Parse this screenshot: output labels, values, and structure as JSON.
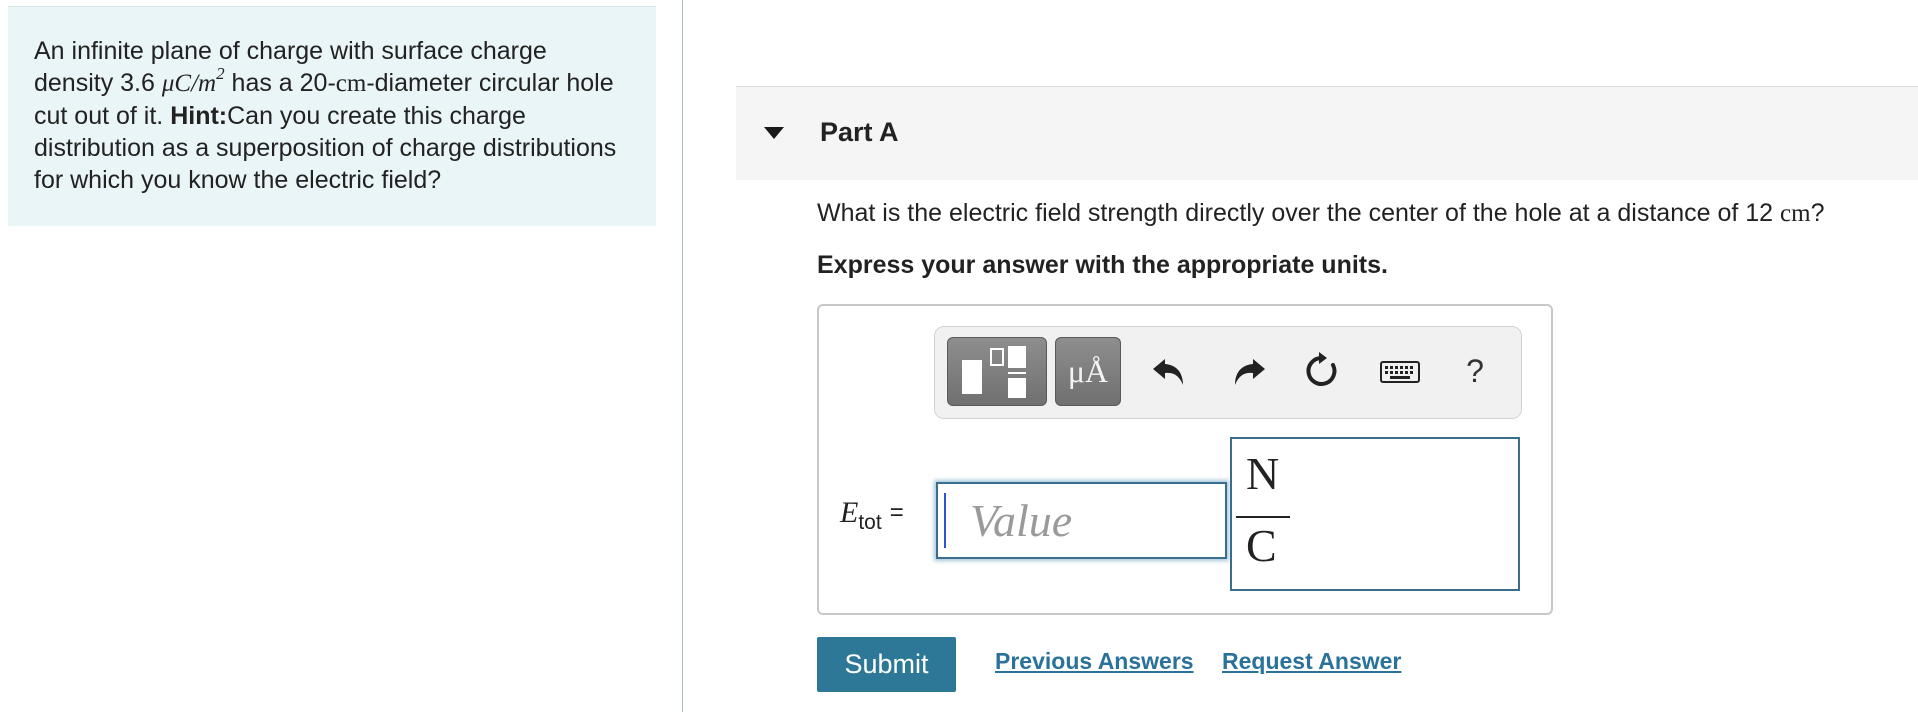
{
  "problem": {
    "text_before_sigma": "An infinite plane of charge with surface charge density 3.6 ",
    "sigma_unit_main": "μC/m",
    "sigma_unit_exp": "2",
    "text_mid_1": " has a 20-",
    "diameter_unit": "cm",
    "text_mid_2": "-diameter circular hole cut out of it. ",
    "hint_label": "Hint:",
    "hint_text": "Can you create this charge distribution as a superposition of charge distributions for which you know the electric field?"
  },
  "part": {
    "title": "Part A",
    "question_text": "What is the electric field strength directly over the center of the hole at a distance of 12 ",
    "question_unit": "cm",
    "question_end": "?",
    "instruction": "Express your answer with the appropriate units."
  },
  "toolbar": {
    "units_label": "μÅ",
    "help_label": "?"
  },
  "answer": {
    "var_symbol": "E",
    "var_subscript": "tot",
    "equals": "=",
    "value": "",
    "placeholder": "Value",
    "unit_numerator": "N",
    "unit_denominator": "C"
  },
  "actions": {
    "submit_label": "Submit",
    "previous_answers_label": "Previous Answers",
    "request_answer_label": "Request Answer"
  },
  "colors": {
    "problem_bg": "#e9f5f7",
    "submit_bg": "#2c7896",
    "link": "#2a7299",
    "input_border": "#3b6d8c"
  }
}
